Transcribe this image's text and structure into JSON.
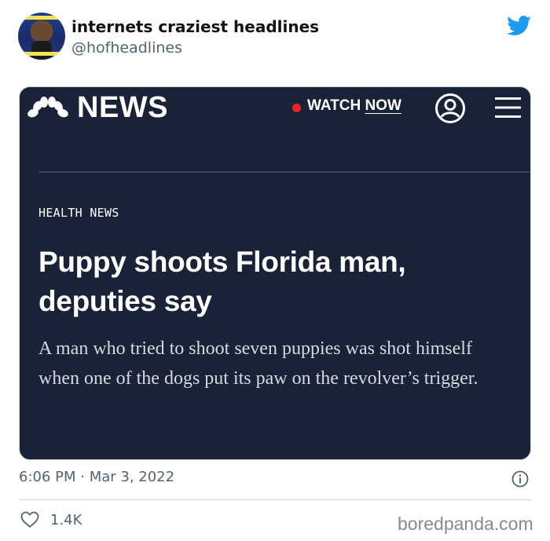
{
  "tweet": {
    "author_name": "internets craziest headlines",
    "author_handle": "@hofheadlines",
    "timestamp": "6:06 PM · Mar 3, 2022",
    "likes": "1.4K",
    "brand_color": "#1d9bf0"
  },
  "card": {
    "brand": "NEWS",
    "watch_label": "WATCH",
    "now_label": "NOW",
    "section": "HEALTH NEWS",
    "headline": "Puppy shoots Florida man, deputies say",
    "dek": "A man who tried to shoot seven puppies was shot himself when one of the dogs put its paw on the revolver’s trigger.",
    "background_color": "#1a2238",
    "live_dot_color": "#e8242b"
  },
  "watermark": "boredpanda.com"
}
